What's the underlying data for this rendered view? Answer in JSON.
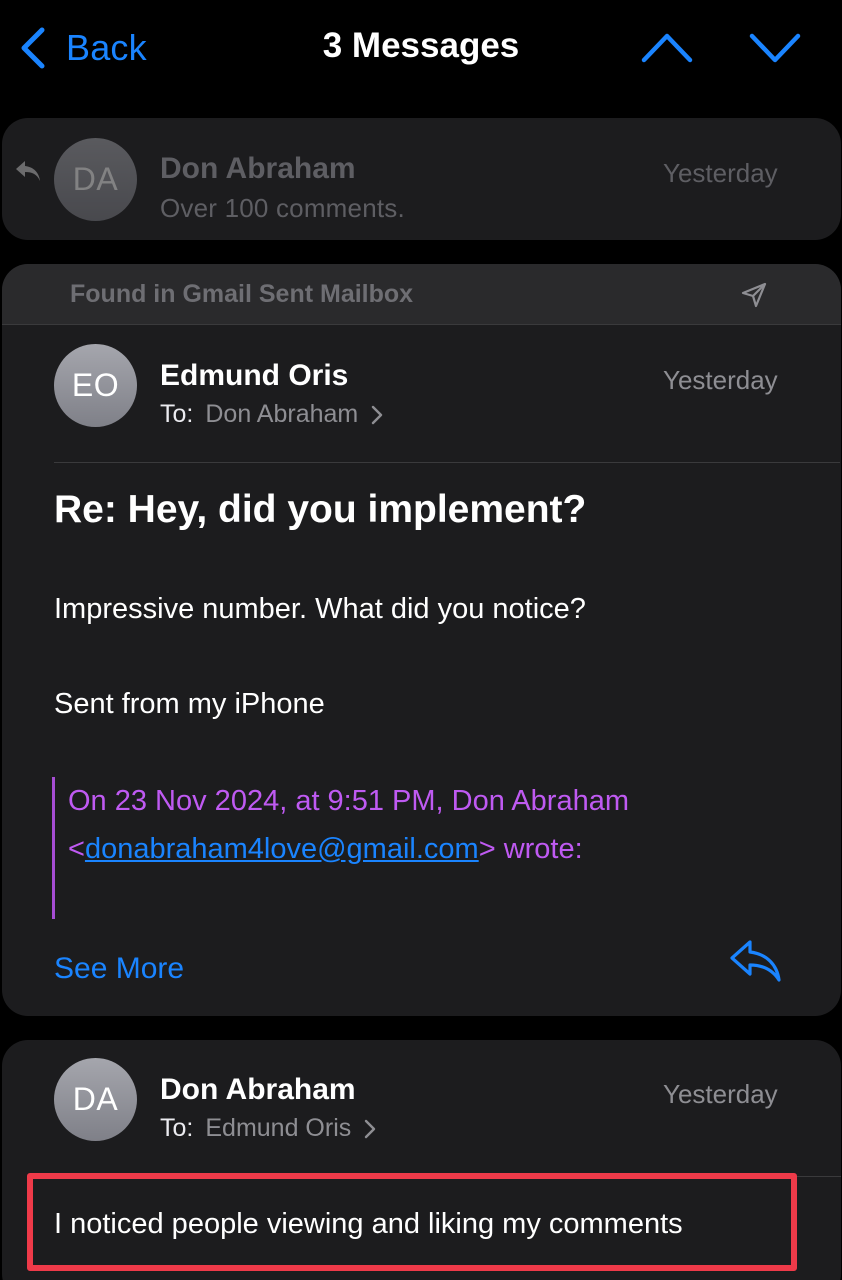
{
  "nav": {
    "back_label": "Back",
    "title": "3 Messages",
    "prev_icon": "chevron-up-icon",
    "next_icon": "chevron-down-icon",
    "accent": "#1a84ff"
  },
  "messages": [
    {
      "avatar_initials": "DA",
      "sender": "Don Abraham",
      "date": "Yesterday",
      "snippet": "Over 100 comments.",
      "replied_icon": "reply-arrow-icon",
      "collapsed": true
    },
    {
      "found_in": "Found in Gmail Sent Mailbox",
      "found_icon": "paper-plane-icon",
      "avatar_initials": "EO",
      "sender": "Edmund Oris",
      "to_label": "To:",
      "to": "Don Abraham",
      "date": "Yesterday",
      "subject": "Re: Hey, did you implement?",
      "body": [
        "Impressive number. What did you notice?",
        "Sent from my iPhone"
      ],
      "quote_prefix_line1": "On 23 Nov 2024, at 9:51 PM, Don Abraham",
      "quote_lt": "<",
      "quote_email": "donabraham4love@gmail.com",
      "quote_suffix": "> wrote:",
      "quote_color": "#bf5af2",
      "see_more": "See More",
      "reply_icon": "reply-icon"
    },
    {
      "avatar_initials": "DA",
      "sender": "Don Abraham",
      "to_label": "To:",
      "to": "Edmund Oris",
      "date": "Yesterday",
      "body_highlighted": "I noticed people viewing and liking my comments",
      "highlight_color": "#ee3a49"
    }
  ]
}
